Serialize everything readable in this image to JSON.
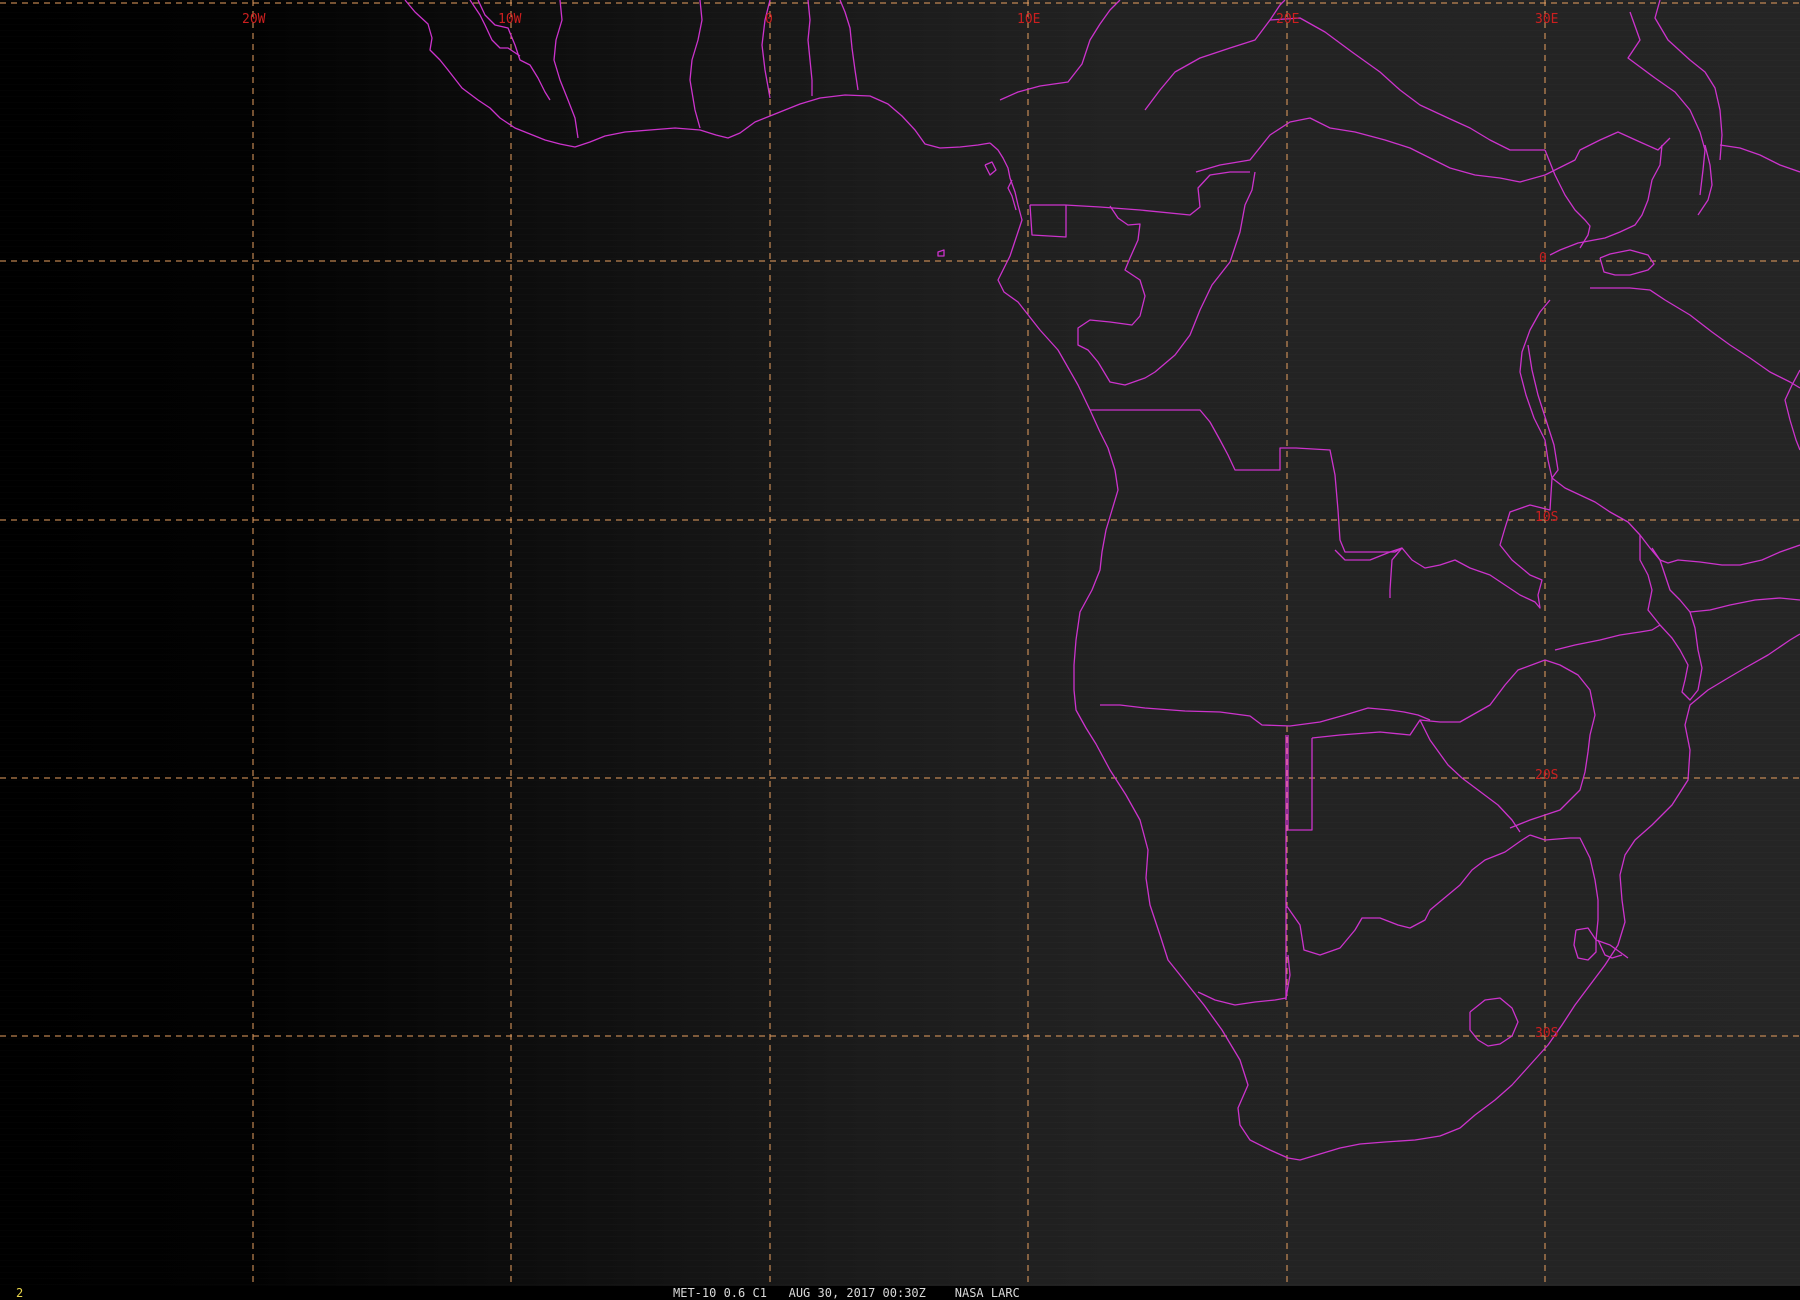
{
  "map": {
    "lon_labels": [
      "20W",
      "10W",
      "0",
      "10E",
      "20E",
      "30E"
    ],
    "lat_labels": [
      "0",
      "10S",
      "20S",
      "30S"
    ],
    "colors": {
      "gridlines": "#e8a060",
      "labels": "#cc1f1f",
      "boundaries": "#cc33cc",
      "background": "#222222"
    }
  },
  "footer": {
    "frame_number": "2",
    "caption": "MET-10 0.6 C1   AUG 30, 2017 00:30Z    NASA LARC"
  }
}
